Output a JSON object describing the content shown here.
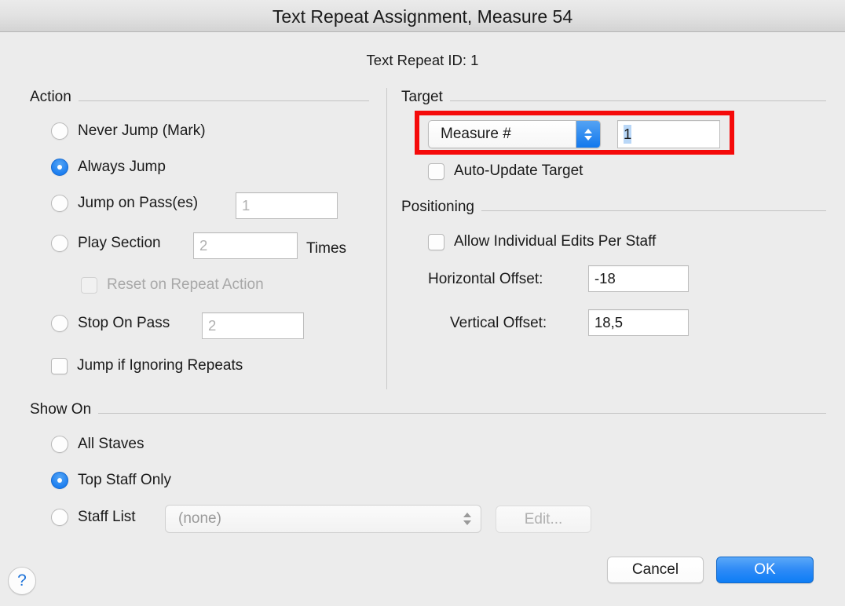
{
  "window": {
    "title": "Text Repeat Assignment, Measure 54",
    "subtitle": "Text Repeat ID: 1"
  },
  "colors": {
    "accent_blue": "#0d7df5",
    "radio_selected": "#1a7df0",
    "highlight_red": "#f50a0a",
    "text_selection": "#b9d7f7",
    "background": "#ececec"
  },
  "action": {
    "title": "Action",
    "options": [
      {
        "label": "Never Jump (Mark)",
        "selected": false
      },
      {
        "label": "Always Jump",
        "selected": true
      },
      {
        "label": "Jump on Pass(es)",
        "selected": false,
        "field_value": "1",
        "field_is_placeholder": true
      },
      {
        "label": "Play Section",
        "selected": false,
        "field_value": "2",
        "field_is_placeholder": true,
        "suffix": "Times"
      },
      {
        "label": "Stop On Pass",
        "selected": false,
        "field_value": "2",
        "field_is_placeholder": true
      }
    ],
    "reset_on_repeat": {
      "label": "Reset on Repeat Action",
      "checked": false,
      "disabled": true
    },
    "jump_if_ignoring": {
      "label": "Jump if Ignoring Repeats",
      "checked": false,
      "disabled": false
    }
  },
  "target": {
    "title": "Target",
    "type_selected": "Measure #",
    "measure_value": "1",
    "auto_update": {
      "label": "Auto-Update Target",
      "checked": false
    }
  },
  "positioning": {
    "title": "Positioning",
    "allow_individual_edits": {
      "label": "Allow Individual Edits Per Staff",
      "checked": false
    },
    "horizontal_offset": {
      "label": "Horizontal Offset:",
      "value": "-18"
    },
    "vertical_offset": {
      "label": "Vertical Offset:",
      "value": "18,5"
    }
  },
  "show_on": {
    "title": "Show On",
    "options": [
      {
        "label": "All Staves",
        "selected": false
      },
      {
        "label": "Top Staff Only",
        "selected": true
      },
      {
        "label": "Staff List",
        "selected": false
      }
    ],
    "staff_list_value": "(none)",
    "edit_button": "Edit..."
  },
  "footer": {
    "help": "?",
    "cancel": "Cancel",
    "ok": "OK"
  }
}
